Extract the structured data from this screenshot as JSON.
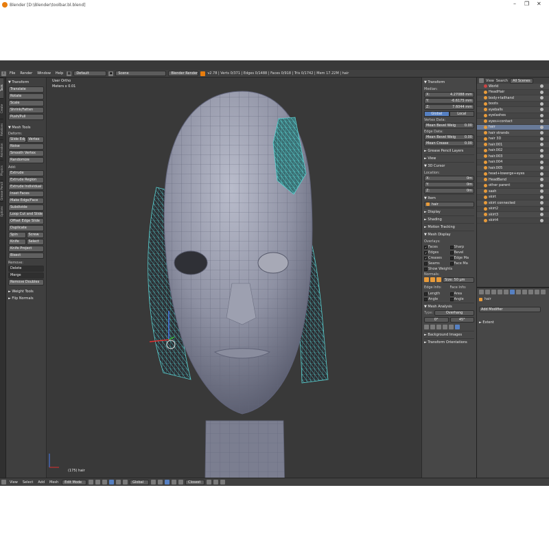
{
  "window": {
    "title": "Blender [D:\\Blender\\toolbar.bl.blend]",
    "min": "–",
    "max": "❐",
    "close": "✕"
  },
  "infobar": {
    "menus": [
      "File",
      "Render",
      "Window",
      "Help"
    ],
    "layout": "Default",
    "scene": "Scene",
    "engine": "Blender Render",
    "stats": "v2.78 | Verts 0/371 | Edges 0/1488 | Faces 0/918 | Tris 0/1742 | Mem 17.22M | hair"
  },
  "tabs": [
    "Tools",
    "Create",
    "Relations",
    "Animation",
    "Physics",
    "Grease Pencil",
    "Options"
  ],
  "toolshelf": {
    "transform_head": "▼ Transform",
    "transform": [
      "Translate",
      "Rotate",
      "Scale",
      "Shrink/Fatten",
      "Push/Pull"
    ],
    "mesh_tools_head": "▼ Mesh Tools",
    "deform_label": "Deform:",
    "slide_edge": "Slide Edge",
    "vertex": "Vertex",
    "deform": [
      "Noise",
      "Smooth Vertex",
      "Randomize"
    ],
    "add_label": "Add:",
    "extrude": "Extrude",
    "add": [
      "Extrude Region",
      "Extrude Individual",
      "Inset Faces",
      "Make Edge/Face",
      "Subdivide",
      "Loop Cut and Slide",
      "Offset Edge Slide",
      "Duplicate"
    ],
    "spin": "Spin",
    "screw": "Screw",
    "knife": "Knife",
    "select": "Select",
    "add2": [
      "Knife Project",
      "Bisect"
    ],
    "remove_label": "Remove:",
    "delete": "Delete",
    "merge": "Merge",
    "remove_doubles": "Remove Doubles",
    "weight_tools": "► Weight Tools",
    "flip_normals": "► Flip Normals"
  },
  "viewport": {
    "view_label": "User Ortho",
    "meters": "Meters x 0.01",
    "object_label": "(175) hair"
  },
  "npanel": {
    "transform_head": "▼ Transform",
    "median": "Median:",
    "x_label": "X:",
    "x_val": "4.27088 mm",
    "y_label": "Y:",
    "y_val": "-6.6175 mm",
    "z_label": "Z:",
    "z_val": "7.6044 mm",
    "global": "Global",
    "local": "Local",
    "vertex_data": "Vertex Data:",
    "mean_bevel_weight": "Mean Bevel Weig",
    "mean_bevel_val": "0.00",
    "edge_data": "Edge Data:",
    "mean_bevel_weight2": "Mean Bevel Weig",
    "mean_bevel_val2": "0.00",
    "mean_crease": "Mean Crease",
    "mean_crease_val": "0.00",
    "grease_pencil": "► Grease Pencil Layers",
    "view": "► View",
    "cursor_head": "▼ 3D Cursor",
    "location": "Location:",
    "cx_label": "X:",
    "cx_val": "0m",
    "cy_label": "Y:",
    "cy_val": "0m",
    "cz_label": "Z:",
    "cz_val": "0m",
    "item_head": "▼ Item",
    "item_name": "hair",
    "display": "► Display",
    "shading": "► Shading",
    "motion_tracking": "► Motion Tracking",
    "mesh_display": "▼ Mesh Display",
    "overlays": "Overlays:",
    "faces": "Faces",
    "sharp": "Sharp",
    "edges": "Edges",
    "bevel": "Bevel",
    "creases": "Creases",
    "edge_ma": "Edge Ma",
    "seams": "Seams",
    "face_ma": "Face Ma",
    "show_weights": "Show Weights",
    "normals": "Normals:",
    "size": "Size: 50 µm",
    "edge_info": "Edge Info:",
    "face_info": "Face Info:",
    "length": "Length",
    "area": "Area",
    "angle": "Angle",
    "angle2": "Angle",
    "mesh_analysis": "▼ Mesh Analysis",
    "type_label": "Type:",
    "type_val": "Overhang",
    "min_val": "0°",
    "max_val": "45°",
    "background_images": "► Background Images",
    "transform_orientations": "► Transform Orientations"
  },
  "outliner": {
    "view": "View",
    "search": "Search",
    "filter": "All Scenes",
    "items": [
      "World",
      "HeadHair",
      "body+tailhand",
      "boots",
      "eyeballs",
      "eyelashes",
      "eyes+contact",
      "hair",
      "hair strands",
      "hair 3D",
      "hair.001",
      "hair.002",
      "hair.003",
      "hair.004",
      "hair.005",
      "head+lowerge+eyes",
      "HeadBand",
      "other parent",
      "sash",
      "skirt",
      "skirt connected",
      "skirt2",
      "skirt3",
      "skirt4"
    ]
  },
  "props": {
    "object": "hair",
    "add_modifier": "Add Modifier",
    "extent": "► Extent"
  },
  "bottombar": {
    "menus": [
      "View",
      "Select",
      "Add",
      "Mesh"
    ],
    "mode": "Edit Mode",
    "orientation": "Global",
    "proportional": "Closest"
  },
  "colors": {
    "accent": "#5680c2",
    "mesh": "#7b7e92",
    "hair": "#5ad2d2",
    "brand": "#e87d0d"
  }
}
